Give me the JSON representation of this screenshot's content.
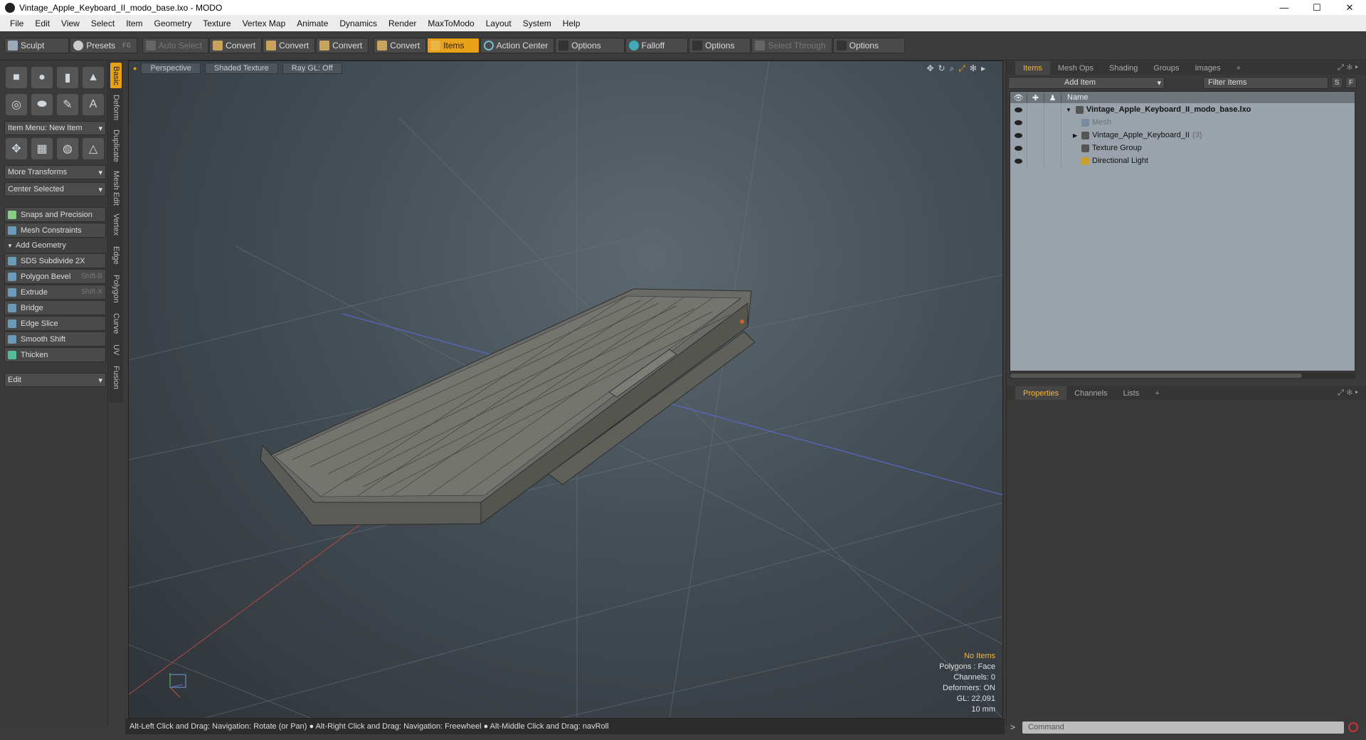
{
  "window": {
    "title": "Vintage_Apple_Keyboard_II_modo_base.lxo - MODO",
    "min": "—",
    "max": "☐",
    "close": "✕"
  },
  "menu": [
    "File",
    "Edit",
    "View",
    "Select",
    "Item",
    "Geometry",
    "Texture",
    "Vertex Map",
    "Animate",
    "Dynamics",
    "Render",
    "MaxToModo",
    "Layout",
    "System",
    "Help"
  ],
  "toolbar": {
    "sculpt": "Sculpt",
    "presets": "Presets",
    "presets_key": "F6",
    "auto_select": "Auto Select",
    "convert1": "Convert",
    "convert2": "Convert",
    "convert3": "Convert",
    "convert4": "Convert",
    "items": "Items",
    "action_center": "Action Center",
    "options1": "Options",
    "falloff": "Falloff",
    "options2": "Options",
    "select_through": "Select Through",
    "options3": "Options"
  },
  "left": {
    "item_menu": "Item Menu: New Item",
    "more_transforms": "More Transforms",
    "center_selected": "Center Selected",
    "snaps": "Snaps and Precision",
    "mesh_constraints": "Mesh Constraints",
    "add_geometry": "Add Geometry",
    "tools": [
      {
        "label": "SDS Subdivide 2X",
        "short": ""
      },
      {
        "label": "Polygon Bevel",
        "short": "Shift-B"
      },
      {
        "label": "Extrude",
        "short": "Shift-X"
      },
      {
        "label": "Bridge",
        "short": ""
      },
      {
        "label": "Edge Slice",
        "short": ""
      },
      {
        "label": "Smooth Shift",
        "short": ""
      },
      {
        "label": "Thicken",
        "short": ""
      }
    ],
    "edit": "Edit"
  },
  "vtabs": [
    "Basic",
    "Deform",
    "Duplicate",
    "Mesh Edit",
    "Vertex",
    "Edge",
    "Polygon",
    "Curve",
    "UV",
    "Fusion"
  ],
  "viewport": {
    "perspective": "Perspective",
    "shaded": "Shaded Texture",
    "raygl": "Ray GL: Off",
    "info": {
      "items": "No Items",
      "polygons": "Polygons : Face",
      "channels": "Channels: 0",
      "deformers": "Deformers: ON",
      "gl": "GL: 22,091",
      "scale": "10 mm"
    }
  },
  "status": "Alt-Left Click and Drag: Navigation: Rotate (or Pan) ● Alt-Right Click and Drag: Navigation: Freewheel ● Alt-Middle Click and Drag: navRoll",
  "right": {
    "tabs": [
      "Items",
      "Mesh Ops",
      "Shading",
      "Groups",
      "Images",
      "+"
    ],
    "add_item": "Add Item",
    "filter": "Filter Items",
    "s": "S",
    "f": "F",
    "col_name": "Name",
    "rows": [
      {
        "name": "Vintage_Apple_Keyboard_II_modo_base.lxo",
        "count": ""
      },
      {
        "name": "Mesh",
        "count": ""
      },
      {
        "name": "Vintage_Apple_Keyboard_II",
        "count": "(3)"
      },
      {
        "name": "Texture Group",
        "count": ""
      },
      {
        "name": "Directional Light",
        "count": ""
      }
    ],
    "prop_tabs": [
      "Properties",
      "Channels",
      "Lists",
      "+"
    ],
    "command": "Command"
  }
}
